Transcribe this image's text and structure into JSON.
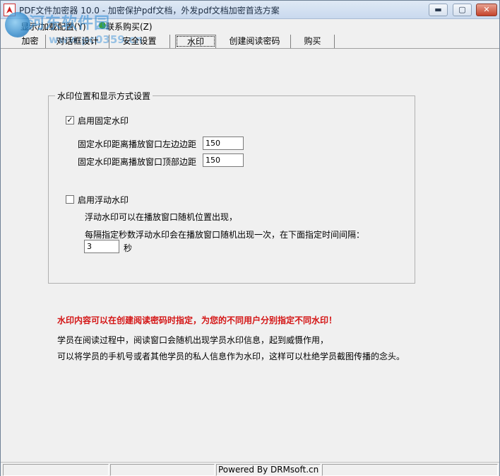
{
  "window": {
    "title": "PDF文件加密器 10.0 - 加密保护pdf文档，外发pdf文档加密首选方案",
    "minimize_glyph": "▬",
    "maximize_glyph": "▢",
    "close_glyph": "✕"
  },
  "watermark": {
    "site_name": "河东软件园",
    "site_url": "www.pc0359.cn"
  },
  "menu": {
    "items": [
      {
        "label": "显示/加载配置(Y)"
      },
      {
        "label": "联系购买(Z)"
      }
    ]
  },
  "tabs": [
    {
      "label": "加密",
      "active": false
    },
    {
      "label": "对话框设计",
      "active": false
    },
    {
      "label": "安全设置",
      "active": false
    },
    {
      "label": "水印",
      "active": true
    },
    {
      "label": "创建阅读密码",
      "active": false
    },
    {
      "label": "购买",
      "active": false
    }
  ],
  "watermark_group": {
    "legend": "水印位置和显示方式设置",
    "fixed": {
      "checked": true,
      "label": "启用固定水印",
      "left_label": "固定水印距离播放窗口左边边距",
      "left_value": "150",
      "top_label": "固定水印距离播放窗口顶部边距",
      "top_value": "150"
    },
    "floating": {
      "checked": false,
      "label": "启用浮动水印",
      "desc1": "浮动水印可以在播放窗口随机位置出现，",
      "desc2": "每隔指定秒数浮动水印会在播放窗口随机出现一次，在下面指定时间间隔：",
      "interval_value": "3",
      "interval_unit": "秒"
    }
  },
  "notes": {
    "red": "水印内容可以在创建阅读密码时指定，为您的不同用户分别指定不同水印！",
    "line1": "学员在阅读过程中，阅读窗口会随机出现学员水印信息，起到威慑作用，",
    "line2": "可以将学员的手机号或者其他学员的私人信息作为水印，这样可以杜绝学员截图传播的念头。"
  },
  "status": {
    "cell1": "",
    "cell2": "",
    "cell3": "Powered By DRMsoft.cn",
    "cell4": ""
  },
  "check_glyph": "✓"
}
